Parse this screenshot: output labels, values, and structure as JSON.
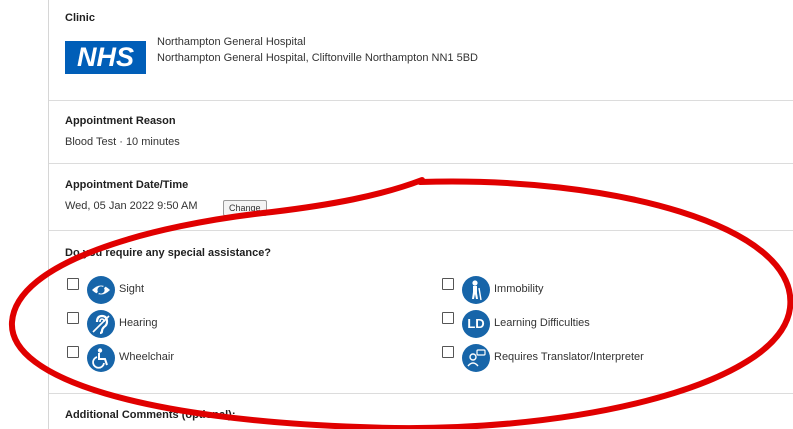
{
  "clinic": {
    "heading": "Clinic",
    "logo_text": "NHS",
    "name": "Northampton General Hospital",
    "address": "Northampton General Hospital, Cliftonville Northampton NN1 5BD"
  },
  "reason": {
    "heading": "Appointment Reason",
    "value": "Blood Test · 10 minutes"
  },
  "datetime": {
    "heading": "Appointment Date/Time",
    "value": "Wed, 05 Jan 2022 9:50 AM",
    "change_label": "Change"
  },
  "assistance": {
    "heading": "Do you require any special assistance?",
    "options": [
      {
        "label": "Sight",
        "icon": "eye-icon",
        "checked": false
      },
      {
        "label": "Immobility",
        "icon": "walking-stick-icon",
        "checked": false
      },
      {
        "label": "Hearing",
        "icon": "ear-icon",
        "checked": false
      },
      {
        "label": "Learning Difficulties",
        "icon": "ld-icon",
        "checked": false
      },
      {
        "label": "Wheelchair",
        "icon": "wheelchair-icon",
        "checked": false
      },
      {
        "label": "Requires Translator/Interpreter",
        "icon": "interpreter-icon",
        "checked": false
      }
    ]
  },
  "comments": {
    "heading": "Additional Comments (optional):"
  },
  "colors": {
    "icon_blue": "#1765a9",
    "nhs_blue": "#005eb8",
    "annotation_red": "#e00000"
  }
}
